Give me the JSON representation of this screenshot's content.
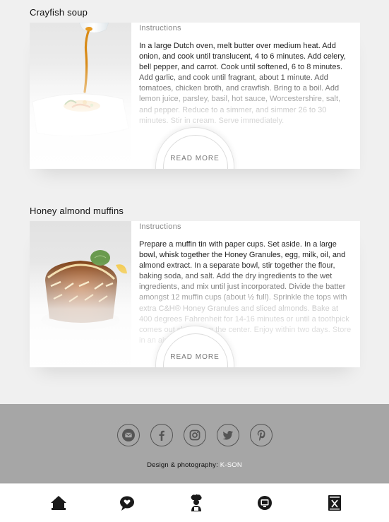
{
  "recipes": [
    {
      "title": "Crayfish soup",
      "subtitle": "Instructions",
      "text": "In a large Dutch oven, melt butter over medium heat. Add onion, and cook until translucent, 4 to 6 minutes. Add celery, bell pepper, and carrot. Cook until softened, 6 to 8 minutes. Add garlic, and cook until fragrant, about 1 minute. Add tomatoes, chicken broth, and crawfish. Bring to a boil. Add lemon juice, parsley, basil, hot sauce, Worcestershire, salt, and pepper. Reduce to a simmer, and simmer 26 to 30 minutes. Stir in cream. Serve immediately.",
      "read_more": "READ MORE"
    },
    {
      "title": "Honey almond muffins",
      "subtitle": "Instructions",
      "text": "Prepare a muffin tin with paper cups. Set aside. In a large bowl, whisk together the Honey Granules, egg, milk, oil, and almond extract. In a separate bowl, stir together the flour, baking soda, and salt. Add the dry ingredients to the wet ingredients, and mix until just incorporated. Divide the batter amongst 12 muffin cups (about ½ full). Sprinkle the tops with extra C&H® Honey Granules and sliced almonds. Bake at 400 degrees Fahrenheit for 14-16 minutes or until a toothpick comes out clean from the center. Enjoy within two days. Store in an airtight container.",
      "read_more": "READ MORE"
    }
  ],
  "footer": {
    "social_icons": [
      "mail-icon",
      "facebook-icon",
      "instagram-icon",
      "twitter-icon",
      "pinterest-icon"
    ],
    "credits_label": "Design & photography:",
    "credits_author": "K-SON"
  },
  "bottom_nav": [
    "home-icon",
    "heart-chat-icon",
    "chef-icon",
    "restaurant-icon",
    "recipe-book-icon"
  ],
  "colors": {
    "background": "#f0f0f0",
    "footer": "#a6a6a6",
    "accent_text": "#ffffff"
  }
}
